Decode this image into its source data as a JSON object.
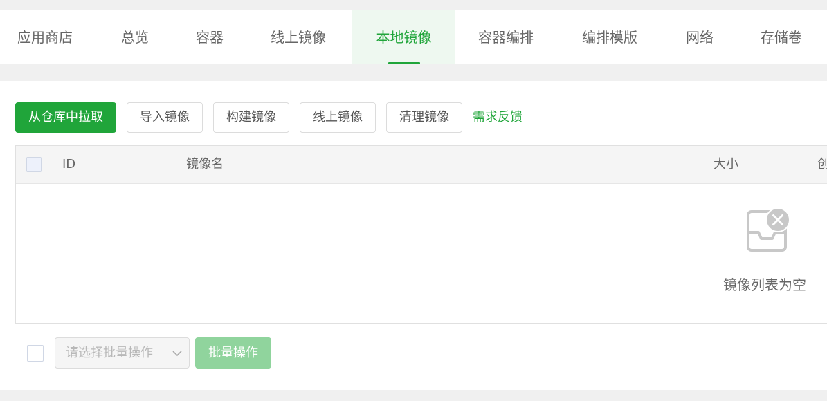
{
  "tabs": [
    {
      "label": "应用商店",
      "active": false
    },
    {
      "label": "总览",
      "active": false
    },
    {
      "label": "容器",
      "active": false
    },
    {
      "label": "线上镜像",
      "active": false
    },
    {
      "label": "本地镜像",
      "active": true
    },
    {
      "label": "容器编排",
      "active": false
    },
    {
      "label": "编排模版",
      "active": false
    },
    {
      "label": "网络",
      "active": false
    },
    {
      "label": "存储卷",
      "active": false
    }
  ],
  "toolbar": {
    "pull_label": "从仓库中拉取",
    "import_label": "导入镜像",
    "build_label": "构建镜像",
    "online_label": "线上镜像",
    "clean_label": "清理镜像",
    "feedback_label": "需求反馈"
  },
  "table": {
    "columns": [
      "ID",
      "镜像名",
      "大小",
      "创"
    ],
    "rows": [],
    "empty_text": "镜像列表为空"
  },
  "footer": {
    "batch_select_placeholder": "请选择批量操作",
    "batch_button_label": "批量操作"
  },
  "colors": {
    "accent": "#20a53a",
    "active_tab_bg": "#eef8f0",
    "disabled_button": "#90d49d",
    "page_bg": "#f0f0f0"
  }
}
